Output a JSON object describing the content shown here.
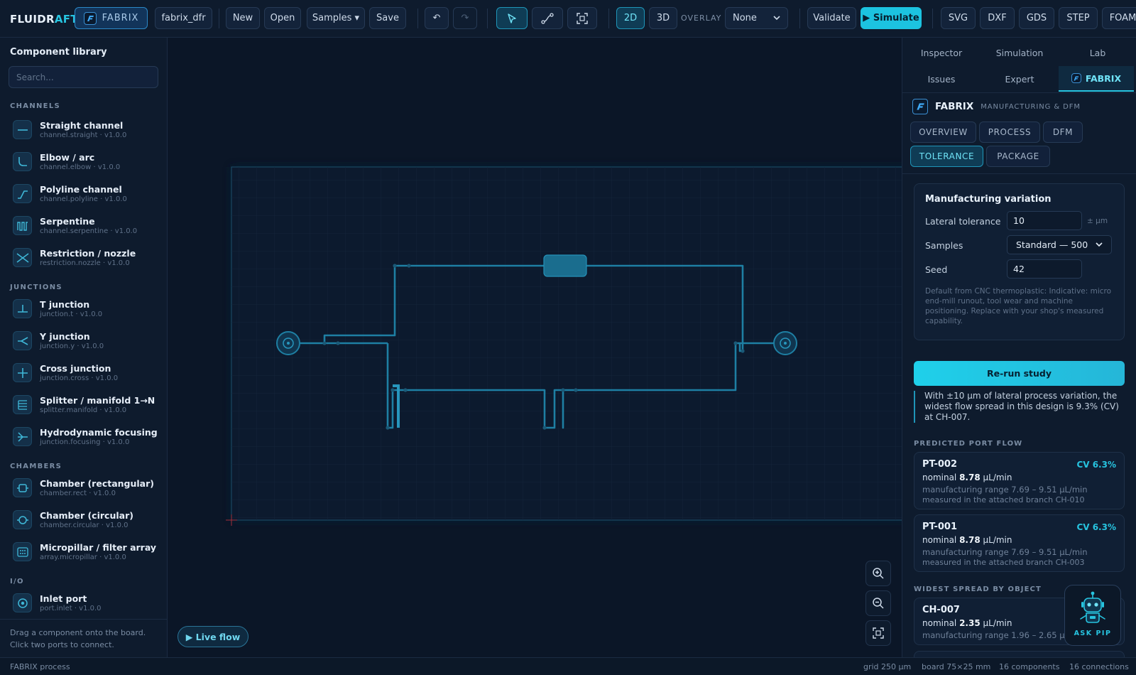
{
  "topbar": {
    "logo_main": "FLUIDR",
    "logo_accent": "AFT",
    "fabrix_label": "FABRIX",
    "file_name": "fabrix_dfr",
    "new_label": "New",
    "open_label": "Open",
    "samples_label": "Samples ▾",
    "save_label": "Save",
    "undo_glyph": "↶",
    "redo_glyph": "↷",
    "view_2d": "2D",
    "view_3d": "3D",
    "overlay_label": "OVERLAY",
    "overlay_value": "None",
    "validate_label": "Validate",
    "simulate_label": "▶ Simulate",
    "export_svg": "SVG",
    "export_dxf": "DXF",
    "export_gds": "GDS",
    "export_step": "STEP",
    "export_foam": "FOAM"
  },
  "sidebar": {
    "title": "Component library",
    "search_placeholder": "Search...",
    "categories": [
      "CHANNELS",
      "JUNCTIONS",
      "CHAMBERS",
      "I/O"
    ],
    "items": [
      {
        "name": "Straight channel",
        "id": "channel.straight · v1.0.0",
        "icon": "straight-channel-icon"
      },
      {
        "name": "Elbow / arc",
        "id": "channel.elbow · v1.0.0",
        "icon": "elbow-icon"
      },
      {
        "name": "Polyline channel",
        "id": "channel.polyline · v1.0.0",
        "icon": "polyline-icon"
      },
      {
        "name": "Serpentine",
        "id": "channel.serpentine · v1.0.0",
        "icon": "serpentine-icon"
      },
      {
        "name": "Restriction / nozzle",
        "id": "restriction.nozzle · v1.0.0",
        "icon": "nozzle-icon"
      },
      {
        "name": "T junction",
        "id": "junction.t · v1.0.0",
        "icon": "t-junction-icon"
      },
      {
        "name": "Y junction",
        "id": "junction.y · v1.0.0",
        "icon": "y-junction-icon"
      },
      {
        "name": "Cross junction",
        "id": "junction.cross · v1.0.0",
        "icon": "cross-junction-icon"
      },
      {
        "name": "Splitter / manifold 1→N",
        "id": "splitter.manifold · v1.0.0",
        "icon": "manifold-icon"
      },
      {
        "name": "Hydrodynamic focusing",
        "id": "junction.focusing · v1.0.0",
        "icon": "focusing-icon"
      },
      {
        "name": "Chamber (rectangular)",
        "id": "chamber.rect · v1.0.0",
        "icon": "rect-chamber-icon"
      },
      {
        "name": "Chamber (circular)",
        "id": "chamber.circular · v1.0.0",
        "icon": "circular-chamber-icon"
      },
      {
        "name": "Micropillar / filter array",
        "id": "array.micropillar · v1.0.0",
        "icon": "micropillar-icon"
      },
      {
        "name": "Inlet port",
        "id": "port.inlet · v1.0.0",
        "icon": "inlet-port-icon"
      }
    ],
    "footer_line1": "Drag a component onto the board.",
    "footer_line2": "Click two ports to connect."
  },
  "canvas": {
    "live_flow_label": "▶ Live flow"
  },
  "right": {
    "tabs_row1": [
      "Inspector",
      "Simulation",
      "Lab"
    ],
    "tabs_row2": [
      "Issues",
      "Expert",
      "FABRIX"
    ],
    "fabrix_title": "FABRIX",
    "fabrix_subtitle": "MANUFACTURING & DFM",
    "subtabs": [
      "OVERVIEW",
      "PROCESS",
      "DFM",
      "TOLERANCE",
      "PACKAGE"
    ],
    "variation": {
      "title": "Manufacturing variation",
      "lateral_label": "Lateral tolerance",
      "lateral_value": "10",
      "lateral_unit": "± µm",
      "samples_label": "Samples",
      "samples_value": "Standard — 500",
      "seed_label": "Seed",
      "seed_value": "42",
      "note": "Default from CNC thermoplastic: Indicative: micro end-mill runout, tool wear and machine positioning. Replace with your shop's measured capability."
    },
    "rerun_label": "Re-run study",
    "summary": "With ±10 µm of lateral process variation, the widest flow spread in this design is 9.3% (CV) at CH-007.",
    "port_flow_heading": "PREDICTED PORT FLOW",
    "ports": [
      {
        "id": "PT-002",
        "cv": "CV 6.3%",
        "nominal_prefix": "nominal ",
        "nominal_value": "8.78",
        "nominal_unit": " µL/min",
        "range": "manufacturing range 7.69 – 9.51 µL/min",
        "branch": "measured in the attached branch CH-010"
      },
      {
        "id": "PT-001",
        "cv": "CV 6.3%",
        "nominal_prefix": "nominal ",
        "nominal_value": "8.78",
        "nominal_unit": " µL/min",
        "range": "manufacturing range 7.69 – 9.51 µL/min",
        "branch": "measured in the attached branch CH-003"
      }
    ],
    "spread_heading": "WIDEST SPREAD BY OBJECT",
    "objects": [
      {
        "id": "CH-007",
        "nominal_prefix": "nominal ",
        "nominal_value": "2.35",
        "nominal_unit": " µL/min",
        "range": "manufacturing range 1.96 – 2.65 µL/min"
      }
    ],
    "pip_label": "ASK PIP"
  },
  "status": {
    "left": "FABRIX process",
    "grid": "grid 250 µm",
    "board": "board 75×25 mm",
    "components": "16 components",
    "connections": "16 connections"
  },
  "colors": {
    "accent": "#27c4e0",
    "background": "#0b1627",
    "panel": "#0e1b2d",
    "channel": "#1e7fa3"
  }
}
